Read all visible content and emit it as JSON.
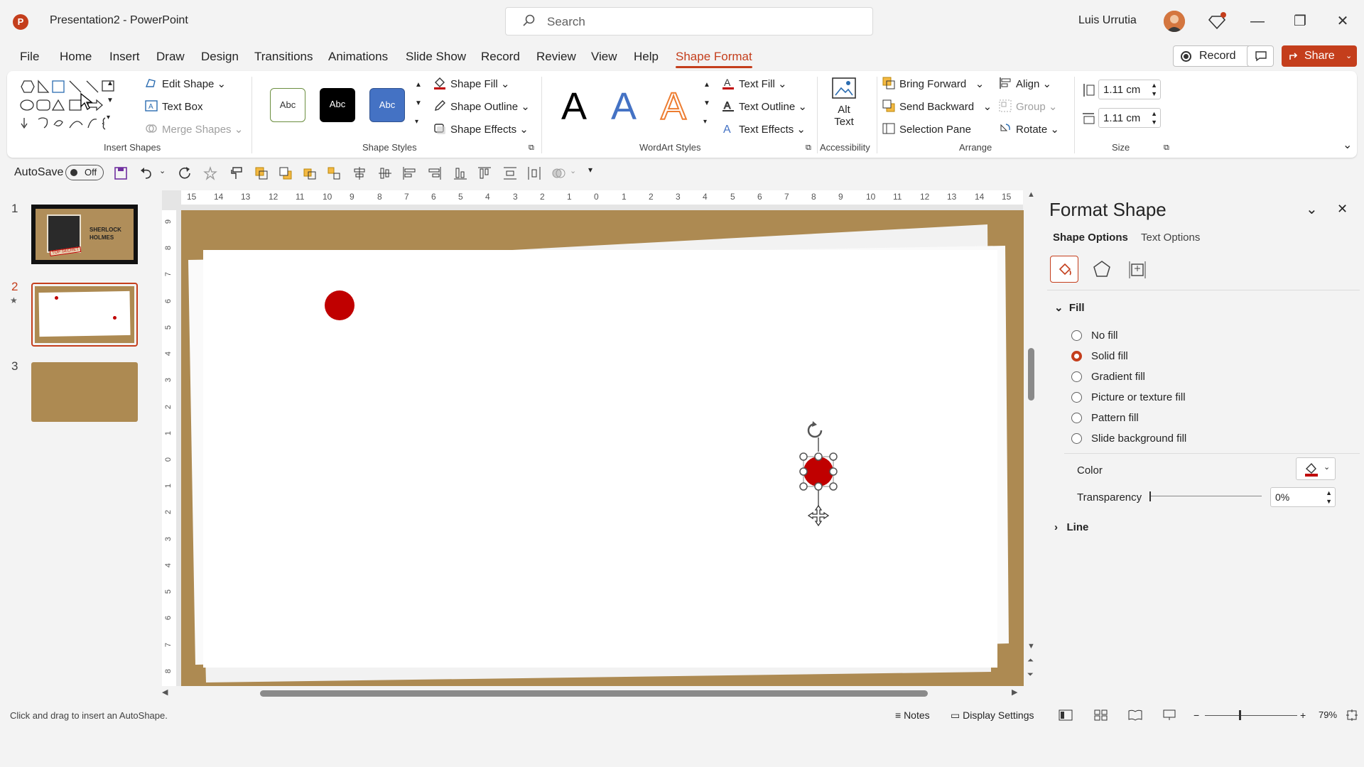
{
  "title_bar": {
    "app_letter": "P",
    "document_title": "Presentation2 - PowerPoint",
    "search_placeholder": "Search",
    "user_name": "Luis Urrutia",
    "minimize": "—",
    "restore": "❐",
    "close": "✕"
  },
  "menu": {
    "tabs": [
      "File",
      "Home",
      "Insert",
      "Draw",
      "Design",
      "Transitions",
      "Animations",
      "Slide Show",
      "Record",
      "Review",
      "View",
      "Help",
      "Shape Format"
    ],
    "active_tab": "Shape Format",
    "record_label": "Record",
    "share_label": "Share"
  },
  "ribbon": {
    "insert_shapes": {
      "edit_shape": "Edit Shape",
      "text_box": "Text Box",
      "merge_shapes": "Merge Shapes",
      "label": "Insert Shapes"
    },
    "shape_styles": {
      "previews": [
        "Abc",
        "Abc",
        "Abc"
      ],
      "shape_fill": "Shape Fill",
      "shape_outline": "Shape Outline",
      "shape_effects": "Shape Effects",
      "label": "Shape Styles"
    },
    "wordart": {
      "letters": [
        "A",
        "A",
        "A"
      ],
      "text_fill": "Text Fill",
      "text_outline": "Text Outline",
      "text_effects": "Text Effects",
      "label": "WordArt Styles"
    },
    "accessibility": {
      "alt_text_line1": "Alt",
      "alt_text_line2": "Text",
      "label": "Accessibility"
    },
    "arrange": {
      "bring_forward": "Bring Forward",
      "send_backward": "Send Backward",
      "selection_pane": "Selection Pane",
      "align": "Align",
      "group": "Group",
      "rotate": "Rotate",
      "label": "Arrange"
    },
    "size": {
      "height": "1.11 cm",
      "width": "1.11 cm",
      "label": "Size"
    }
  },
  "qat": {
    "autosave_label": "AutoSave",
    "autosave_state": "Off"
  },
  "slides": {
    "numbers": [
      "1",
      "2",
      "3"
    ],
    "current": "2",
    "thumb1_title_line1": "SHERLOCK",
    "thumb1_title_line2": "HOLMES",
    "thumb1_stamp": "TOP SECRET"
  },
  "rulers": {
    "horizontal": [
      "15",
      "14",
      "13",
      "12",
      "11",
      "10",
      "9",
      "8",
      "7",
      "6",
      "5",
      "4",
      "3",
      "2",
      "1",
      "0",
      "1",
      "2",
      "3",
      "4",
      "5",
      "6",
      "7",
      "8",
      "9",
      "10",
      "11",
      "12",
      "13",
      "14",
      "15"
    ],
    "vertical": [
      "9",
      "8",
      "7",
      "6",
      "5",
      "4",
      "3",
      "2",
      "1",
      "0",
      "1",
      "2",
      "3",
      "4",
      "5",
      "6",
      "7",
      "8"
    ]
  },
  "format_panel": {
    "title": "Format Shape",
    "tab_shape": "Shape Options",
    "tab_text": "Text Options",
    "fill_header": "Fill",
    "options": [
      "No fill",
      "Solid fill",
      "Gradient fill",
      "Picture or texture fill",
      "Pattern fill",
      "Slide background fill"
    ],
    "selected_option": "Solid fill",
    "color_label": "Color",
    "transparency_label": "Transparency",
    "transparency_value": "0%",
    "line_header": "Line"
  },
  "status": {
    "message": "Click and drag to insert an AutoShape.",
    "notes": "Notes",
    "display_settings": "Display Settings",
    "zoom": "79%",
    "zoom_minus": "−",
    "zoom_plus": "+"
  },
  "colors": {
    "accent": "#c43e1c",
    "slide_background": "#ad8a52",
    "circle_red": "#c00000"
  }
}
